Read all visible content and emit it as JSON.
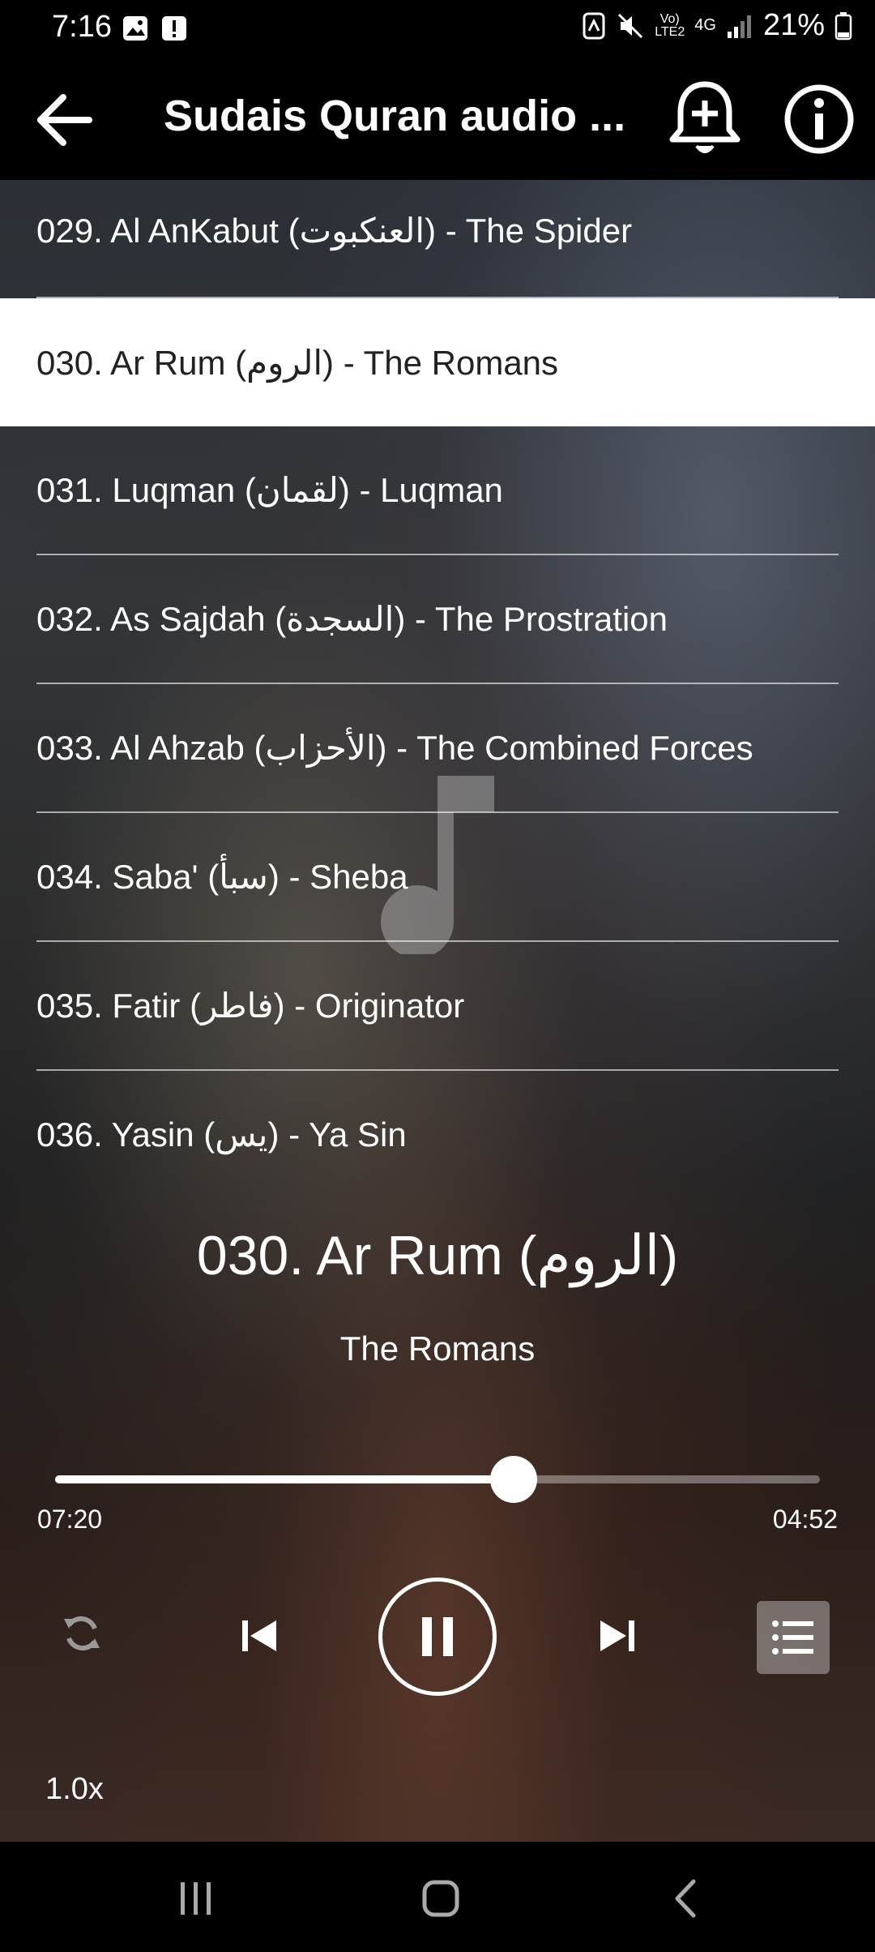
{
  "status_bar": {
    "time": "7:16",
    "network": "4G",
    "battery": "21%"
  },
  "app_bar": {
    "title": "Sudais Quran audio ..."
  },
  "surah_list": [
    {
      "label": "029. Al AnKabut (العنكبوت) - The Spider",
      "selected": false
    },
    {
      "label": "030. Ar Rum (الروم) - The Romans",
      "selected": true
    },
    {
      "label": "031. Luqman (لقمان) - Luqman",
      "selected": false
    },
    {
      "label": "032. As Sajdah (السجدة) - The Prostration",
      "selected": false
    },
    {
      "label": "033. Al Ahzab (الأحزاب) - The Combined Forces",
      "selected": false
    },
    {
      "label": "034. Saba' (سبأ) - Sheba",
      "selected": false
    },
    {
      "label": "035. Fatir (فاطر) - Originator",
      "selected": false
    },
    {
      "label": "036. Yasin (يس) - Ya Sin",
      "selected": false
    }
  ],
  "now_playing": {
    "title": "030. Ar Rum (الروم)",
    "subtitle": "The Romans"
  },
  "player": {
    "current_time": "07:20",
    "total_time": "04:52",
    "progress": 0.6,
    "speed": "1.0x"
  },
  "colors": {
    "accent": "#ffffff",
    "bar_background": "#000000",
    "selected_row": "#ffffff"
  }
}
